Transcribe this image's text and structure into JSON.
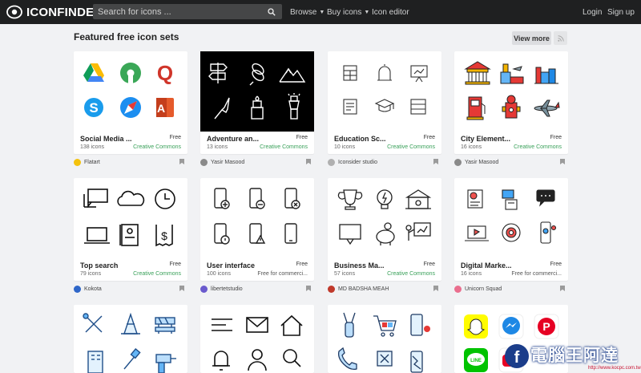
{
  "brand": {
    "name": "ICONFINDER"
  },
  "search": {
    "placeholder": "Search for icons ..."
  },
  "nav": {
    "browse": "Browse",
    "buy_icons": "Buy icons",
    "icon_editor": "Icon editor",
    "login": "Login",
    "signup": "Sign up"
  },
  "section": {
    "title": "Featured free icon sets",
    "view_more": "View more"
  },
  "cards": [
    {
      "title": "Social Media ...",
      "price": "Free",
      "count": "138 icons",
      "license": "Creative Commons",
      "author": "Flatart"
    },
    {
      "title": "Adventure an...",
      "price": "Free",
      "count": "13 icons",
      "license": "Creative Commons",
      "author": "Yasir Masood"
    },
    {
      "title": "Education Sc...",
      "price": "Free",
      "count": "10 icons",
      "license": "Creative Commons",
      "author": "Iconsider studio"
    },
    {
      "title": "City Element...",
      "price": "Free",
      "count": "16 icons",
      "license": "Creative Commons",
      "author": "Yasir Masood"
    },
    {
      "title": "Top search",
      "price": "Free",
      "count": "79 icons",
      "license": "Creative Commons",
      "author": "Kokota"
    },
    {
      "title": "User interface",
      "price": "Free",
      "count": "100 icons",
      "license": "Free for commerci...",
      "author": "libertetstudio"
    },
    {
      "title": "Business Ma...",
      "price": "Free",
      "count": "57 icons",
      "license": "Creative Commons",
      "author": "MD BADSHA MEAH"
    },
    {
      "title": "Digital Marke...",
      "price": "Free",
      "count": "16 icons",
      "license": "Free for commerci...",
      "author": "Unicorn Squad"
    }
  ],
  "watermark": {
    "text": "電腦王阿達",
    "url": "http://www.kocpc.com.tw"
  },
  "colors": {
    "topbar": "#1f2021",
    "license_green": "#3aa15a",
    "page_bg": "#f1f2f4"
  },
  "icons": {
    "search": "magnifier-icon",
    "rss": "rss-icon"
  }
}
